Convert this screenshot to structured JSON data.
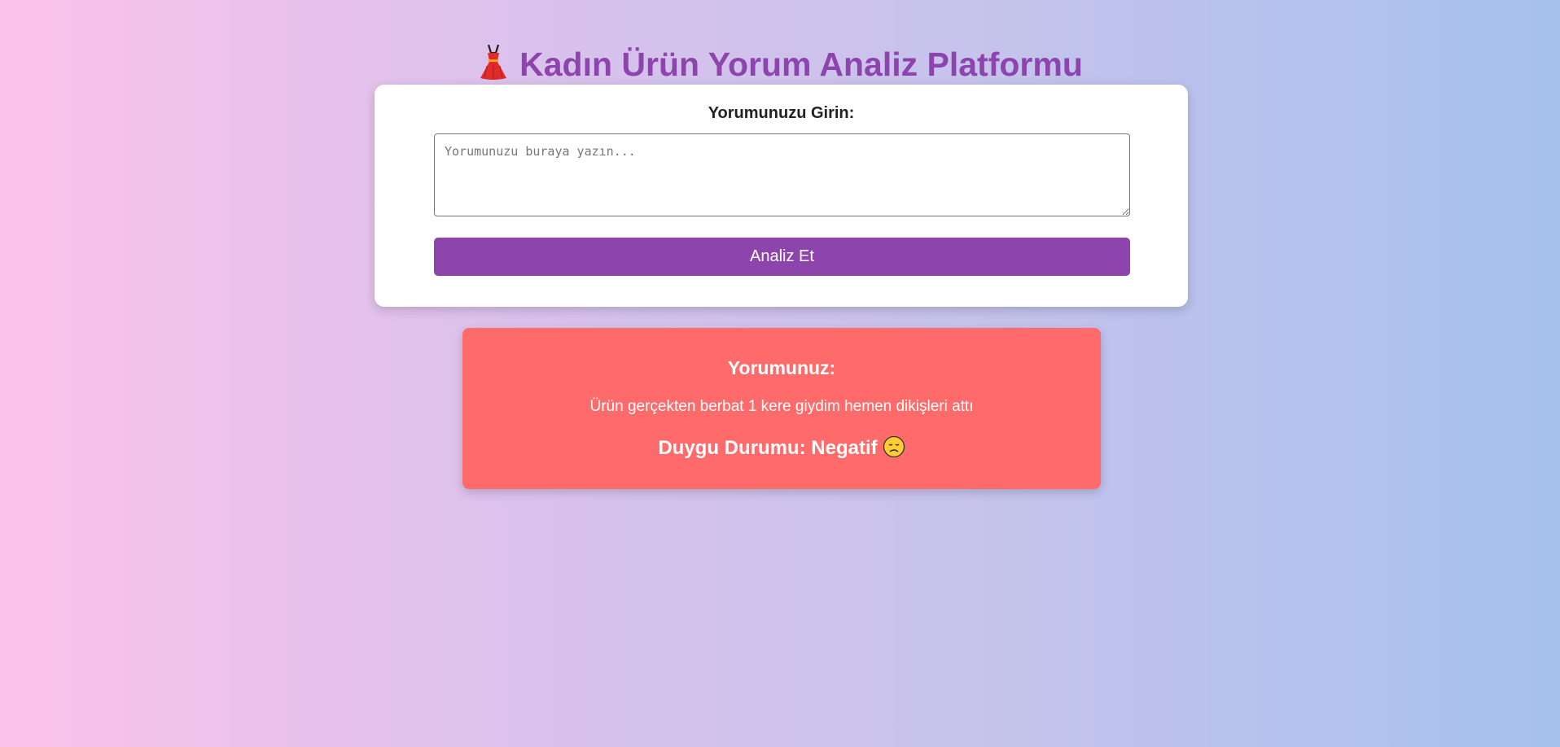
{
  "header": {
    "title": "Kadın Ürün Yorum Analiz Platformu",
    "title_icon": "dress-icon",
    "title_color": "#8e44ad"
  },
  "form": {
    "label": "Yorumunuzu Girin:",
    "textarea_value": "",
    "textarea_placeholder": "Yorumunuzu buraya yazın...",
    "submit_label": "Analiz Et",
    "submit_color": "#8e44ad"
  },
  "result": {
    "heading": "Yorumunuz:",
    "review_text": "Ürün gerçekten berbat 1 kere giydim hemen dikişleri attı",
    "sentiment_label": "Duygu Durumu: Negatif",
    "sentiment_icon": "sad-face-icon",
    "background_color": "#ff6b6b"
  },
  "background": {
    "gradient_start": "#fbc2eb",
    "gradient_end": "#a6c1ee"
  }
}
